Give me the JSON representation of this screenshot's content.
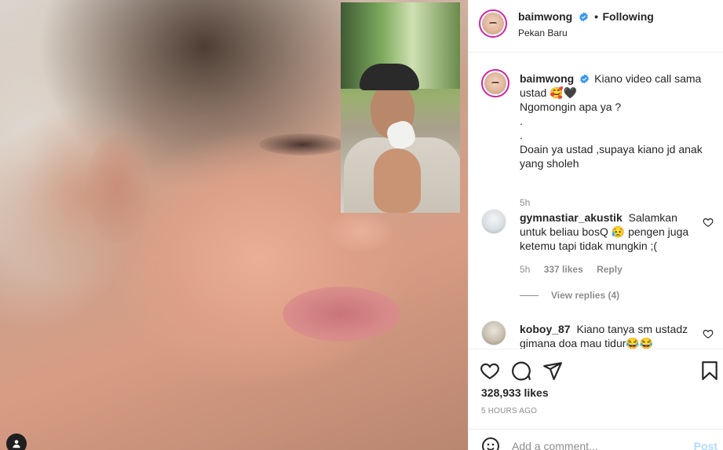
{
  "post": {
    "username": "baimwong",
    "following_label": "Following",
    "separator": "•",
    "location": "Pekan Baru"
  },
  "caption": {
    "username": "baimwong",
    "line1": "Kiano video call sama",
    "line2_prefix": "ustad",
    "emoji1": "🥰",
    "emoji2": "🖤",
    "line3": "Ngomongin apa ya ?",
    "dot1": ".",
    "dot2": ".",
    "line6": "Doain ya ustad ,supaya kiano jd anak",
    "line7": "yang sholeh",
    "time": "5h"
  },
  "comments": [
    {
      "username": "gymnastiar_akustik",
      "text_before": "Salamkan untuk beliau bosQ",
      "emoji": "😥",
      "text_after": "pengen juga ketemu tapi tidak mungkin ;(",
      "time": "5h",
      "likes": "337 likes",
      "reply": "Reply",
      "view_replies": "View replies (4)"
    },
    {
      "username": "koboy_87",
      "text": "Kiano tanya sm ustadz gimana doa mau tidur",
      "emoji": "😂😂"
    }
  ],
  "stats": {
    "likes": "328,933 likes",
    "ago": "5 HOURS AGO"
  },
  "add_comment": {
    "placeholder": "Add a comment...",
    "post": "Post"
  },
  "colors": {
    "accent_blue": "#0095f6",
    "verified_blue": "#3897f0",
    "story_ring": "#d6249f",
    "muted": "#8e8e8e"
  }
}
